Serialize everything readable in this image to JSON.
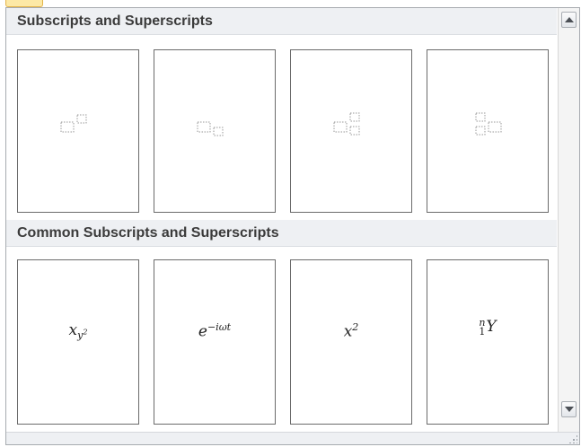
{
  "sections": [
    {
      "title": "Subscripts and Superscripts",
      "tiles": [
        {
          "name": "superscript-template"
        },
        {
          "name": "subscript-template"
        },
        {
          "name": "subscript-superscript-template"
        },
        {
          "name": "left-subscript-superscript-template"
        }
      ]
    },
    {
      "title": "Common Subscripts and Superscripts",
      "tiles": [
        {
          "name": "x-sub-y-squared",
          "base": "x",
          "sub": "y",
          "sub_sup": "2"
        },
        {
          "name": "e-to-minus-i-omega-t",
          "base": "e",
          "sup": "−iωt"
        },
        {
          "name": "x-squared",
          "base": "x",
          "sup": "2"
        },
        {
          "name": "n-over-1-Y",
          "pre_sup": "n",
          "pre_sub": "1",
          "base": "Y"
        }
      ]
    }
  ]
}
